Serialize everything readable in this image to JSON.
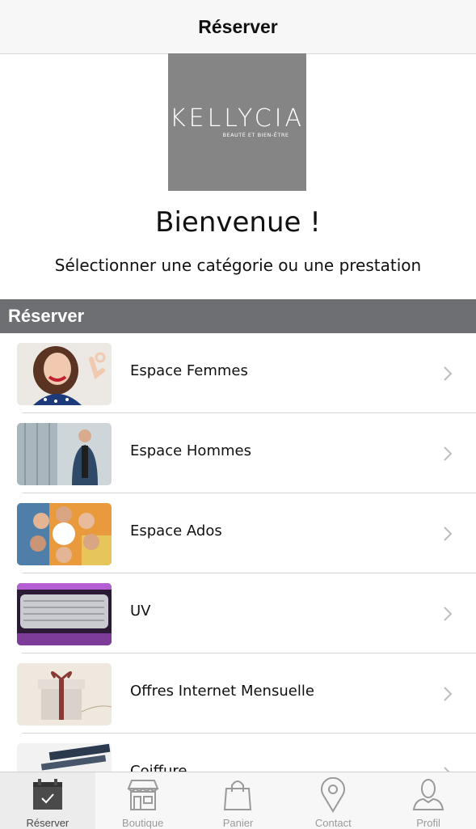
{
  "header": {
    "title": "Réserver"
  },
  "logo": {
    "brand": "KELLYCIA",
    "tagline": "BEAUTÉ ET BIEN-ÊTRE"
  },
  "welcome": {
    "title": "Bienvenue !",
    "subtitle": "Sélectionner une catégorie ou une prestation"
  },
  "section": {
    "title": "Réserver"
  },
  "items": [
    {
      "label": "Espace Femmes"
    },
    {
      "label": "Espace Hommes"
    },
    {
      "label": "Espace Ados"
    },
    {
      "label": "UV"
    },
    {
      "label": "Offres Internet Mensuelle"
    },
    {
      "label": "Coiffure"
    }
  ],
  "tabs": [
    {
      "label": "Réserver",
      "icon": "calendar-check-icon",
      "active": true
    },
    {
      "label": "Boutique",
      "icon": "shop-icon",
      "active": false
    },
    {
      "label": "Panier",
      "icon": "bag-icon",
      "active": false
    },
    {
      "label": "Contact",
      "icon": "location-pin-icon",
      "active": false
    },
    {
      "label": "Profil",
      "icon": "person-icon",
      "active": false
    }
  ],
  "colors": {
    "section_header": "#6e6f73",
    "logo_bg": "#858585",
    "tab_active": "#4a4a4a",
    "tab_inactive": "#9a9a9a"
  }
}
